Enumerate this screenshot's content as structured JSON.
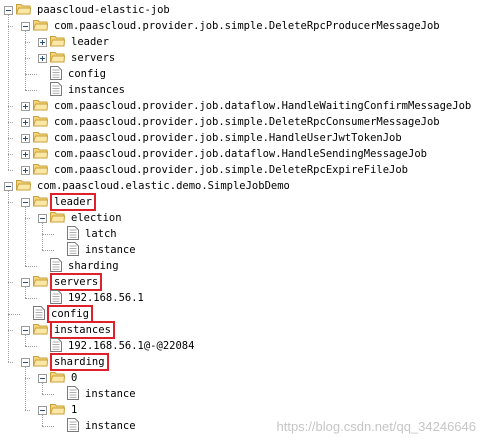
{
  "tree": [
    {
      "label": "paascloud-elastic-job",
      "depth": 0,
      "expanded": true,
      "type": "folder",
      "toggle": "minus",
      "boxed": false
    },
    {
      "label": "com.paascloud.provider.job.simple.DeleteRpcProducerMessageJob",
      "depth": 1,
      "type": "folder",
      "toggle": "minus",
      "boxed": false
    },
    {
      "label": "leader",
      "depth": 2,
      "type": "folder",
      "toggle": "plus",
      "boxed": false
    },
    {
      "label": "servers",
      "depth": 2,
      "type": "folder",
      "toggle": "plus",
      "boxed": false
    },
    {
      "label": "config",
      "depth": 2,
      "type": "file",
      "toggle": "none",
      "boxed": false
    },
    {
      "label": "instances",
      "depth": 2,
      "type": "file",
      "toggle": "none",
      "boxed": false
    },
    {
      "label": "com.paascloud.provider.job.dataflow.HandleWaitingConfirmMessageJob",
      "depth": 1,
      "type": "folder",
      "toggle": "plus",
      "boxed": false
    },
    {
      "label": "com.paascloud.provider.job.simple.DeleteRpcConsumerMessageJob",
      "depth": 1,
      "type": "folder",
      "toggle": "plus",
      "boxed": false
    },
    {
      "label": "com.paascloud.provider.job.simple.HandleUserJwtTokenJob",
      "depth": 1,
      "type": "folder",
      "toggle": "plus",
      "boxed": false
    },
    {
      "label": "com.paascloud.provider.job.dataflow.HandleSendingMessageJob",
      "depth": 1,
      "type": "folder",
      "toggle": "plus",
      "boxed": false
    },
    {
      "label": "com.paascloud.provider.job.simple.DeleteRpcExpireFileJob",
      "depth": 1,
      "type": "folder",
      "toggle": "plus",
      "boxed": false
    },
    {
      "label": "com.paascloud.elastic.demo.SimpleJobDemo",
      "depth": 0,
      "type": "folder",
      "toggle": "minus",
      "boxed": false
    },
    {
      "label": "leader",
      "depth": 1,
      "type": "folder",
      "toggle": "minus",
      "boxed": true
    },
    {
      "label": "election",
      "depth": 2,
      "type": "folder",
      "toggle": "minus",
      "boxed": false
    },
    {
      "label": "latch",
      "depth": 3,
      "type": "file",
      "toggle": "none",
      "boxed": false
    },
    {
      "label": "instance",
      "depth": 3,
      "type": "file",
      "toggle": "none",
      "boxed": false
    },
    {
      "label": "sharding",
      "depth": 2,
      "type": "file",
      "toggle": "none",
      "boxed": false
    },
    {
      "label": "servers",
      "depth": 1,
      "type": "folder",
      "toggle": "minus",
      "boxed": true
    },
    {
      "label": "192.168.56.1",
      "depth": 2,
      "type": "file",
      "toggle": "none",
      "boxed": false
    },
    {
      "label": "config",
      "depth": 1,
      "type": "file",
      "toggle": "none",
      "boxed": true
    },
    {
      "label": "instances",
      "depth": 1,
      "type": "folder",
      "toggle": "minus",
      "boxed": true
    },
    {
      "label": "192.168.56.1@-@22084",
      "depth": 2,
      "type": "file",
      "toggle": "none",
      "boxed": false
    },
    {
      "label": "sharding",
      "depth": 1,
      "type": "folder",
      "toggle": "minus",
      "boxed": true
    },
    {
      "label": "0",
      "depth": 2,
      "type": "folder",
      "toggle": "minus",
      "boxed": false
    },
    {
      "label": "instance",
      "depth": 3,
      "type": "file",
      "toggle": "none",
      "boxed": false
    },
    {
      "label": "1",
      "depth": 2,
      "type": "folder",
      "toggle": "minus",
      "boxed": false
    },
    {
      "label": "instance",
      "depth": 3,
      "type": "file",
      "toggle": "none",
      "boxed": false
    }
  ],
  "watermark": "https://blog.csdn.net/qq_34246646",
  "colors": {
    "folder_fill": "#f6d57a",
    "folder_stroke": "#c9a13a",
    "highlight_box": "#e0202a"
  },
  "icons": {
    "folder": "folder-icon",
    "file": "file-icon"
  }
}
